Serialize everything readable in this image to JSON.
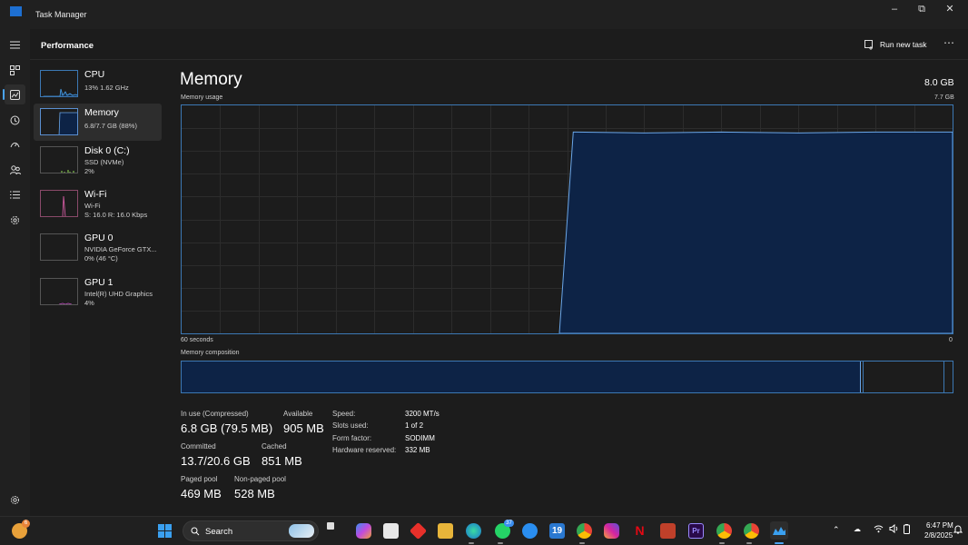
{
  "window": {
    "title": "Task Manager"
  },
  "header": {
    "page_title": "Performance",
    "run_task_label": "Run new task",
    "more": "⋯"
  },
  "devices": [
    {
      "name": "CPU",
      "line1": "13%  1.62 GHz",
      "line2": ""
    },
    {
      "name": "Memory",
      "line1": "6.8/7.7 GB (88%)",
      "line2": ""
    },
    {
      "name": "Disk 0 (C:)",
      "line1": "SSD (NVMe)",
      "line2": "2%"
    },
    {
      "name": "Wi-Fi",
      "line1": "Wi-Fi",
      "line2": "S: 16.0  R: 16.0 Kbps"
    },
    {
      "name": "GPU 0",
      "line1": "NVIDIA GeForce GTX...",
      "line2": "0%  (46 °C)"
    },
    {
      "name": "GPU 1",
      "line1": "Intel(R) UHD Graphics",
      "line2": "4%"
    }
  ],
  "memory": {
    "title": "Memory",
    "total": "8.0 GB",
    "usage_label": "Memory usage",
    "usage_max": "7.7 GB",
    "time_left": "60 seconds",
    "time_right": "0",
    "composition_label": "Memory composition",
    "usage_level": 0.883
  },
  "stats": {
    "in_use_label": "In use (Compressed)",
    "in_use_value": "6.8 GB (79.5 MB)",
    "available_label": "Available",
    "available_value": "905 MB",
    "committed_label": "Committed",
    "committed_value": "13.7/20.6 GB",
    "cached_label": "Cached",
    "cached_value": "851 MB",
    "paged_label": "Paged pool",
    "paged_value": "469 MB",
    "nonpaged_label": "Non-paged pool",
    "nonpaged_value": "528 MB"
  },
  "specs": [
    {
      "label": "Speed:",
      "value": "3200 MT/s"
    },
    {
      "label": "Slots used:",
      "value": "1 of 2"
    },
    {
      "label": "Form factor:",
      "value": "SODIMM"
    },
    {
      "label": "Hardware reserved:",
      "value": "332 MB"
    }
  ],
  "taskbar": {
    "search_label": "Search",
    "time": "6:47 PM",
    "date": "2/8/2025",
    "whatsapp_badge": "37",
    "calendar_day": "19",
    "weather_badge": "6",
    "premiere": "Pr"
  },
  "colors": {
    "accent": "#3c78b4",
    "fill": "#0d2346",
    "background": "#1c1c1c"
  }
}
